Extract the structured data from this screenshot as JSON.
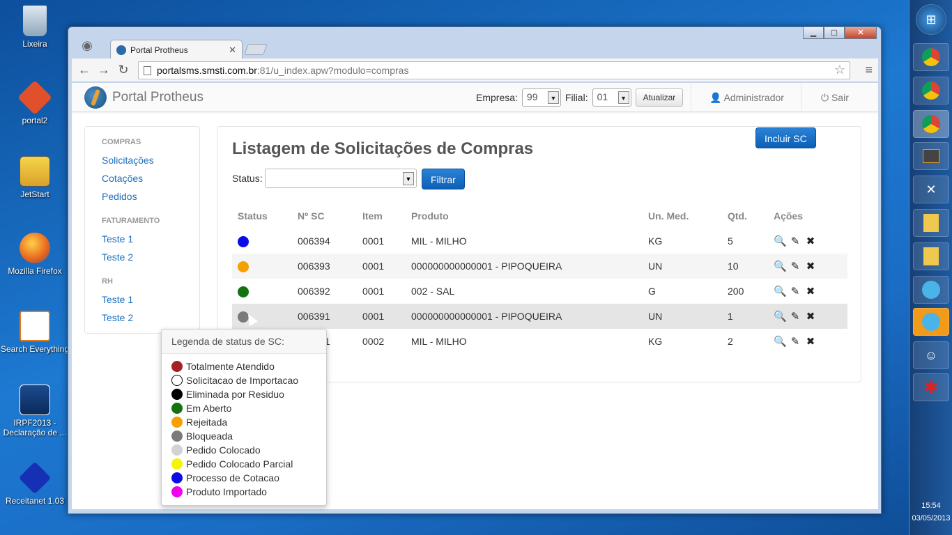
{
  "desktop": {
    "icons": [
      {
        "label": "Lixeira",
        "icon": "recycle-bin-icon"
      },
      {
        "label": "portal2",
        "icon": "git-icon"
      },
      {
        "label": "JetStart",
        "icon": "jetstart-icon"
      },
      {
        "label": "Mozilla Firefox",
        "icon": "firefox-icon"
      },
      {
        "label": "Search Everything",
        "icon": "search-everything-icon"
      },
      {
        "label": "IRPF2013 - Declaração de ...",
        "icon": "irpf-icon"
      },
      {
        "label": "Receitanet 1.03",
        "icon": "receitanet-icon"
      }
    ]
  },
  "taskbar": {
    "time": "15:54",
    "date": "03/05/2013"
  },
  "browser": {
    "tab_title": "Portal Protheus",
    "url_host": "portalsms.smsti.com.br",
    "url_rest": ":81/u_index.apw?modulo=compras"
  },
  "app": {
    "brand": "Portal Protheus",
    "empresa_label": "Empresa:",
    "empresa_value": "99",
    "filial_label": "Filial:",
    "filial_value": "01",
    "atualizar_label": "Atualizar",
    "user_label": "Administrador",
    "sair_label": "Sair"
  },
  "sidebar": {
    "sections": [
      {
        "title": "COMPRAS",
        "items": [
          "Solicitações",
          "Cotações",
          "Pedidos"
        ]
      },
      {
        "title": "FATURAMENTO",
        "items": [
          "Teste 1",
          "Teste 2"
        ]
      },
      {
        "title": "RH",
        "items": [
          "Teste 1",
          "Teste 2"
        ]
      }
    ]
  },
  "main": {
    "incluir_label": "Incluir SC",
    "title": "Listagem de Solicitações de Compras",
    "status_label": "Status:",
    "status_value": "",
    "filtrar_label": "Filtrar",
    "columns": [
      "Status",
      "Nº SC",
      "Item",
      "Produto",
      "Un. Med.",
      "Qtd.",
      "Ações"
    ],
    "rows": [
      {
        "status_color": "#0b0be6",
        "sc": "006394",
        "item": "0001",
        "produto": "MIL - MILHO",
        "un": "KG",
        "qtd": "5"
      },
      {
        "status_color": "#f5a000",
        "sc": "006393",
        "item": "0001",
        "produto": "000000000000001 - PIPOQUEIRA",
        "un": "UN",
        "qtd": "10"
      },
      {
        "status_color": "#137313",
        "sc": "006392",
        "item": "0001",
        "produto": "002 - SAL",
        "un": "G",
        "qtd": "200"
      },
      {
        "status_color": "#7a7a7a",
        "sc": "006391",
        "item": "0001",
        "produto": "000000000000001 - PIPOQUEIRA",
        "un": "UN",
        "qtd": "1"
      },
      {
        "status_color": "#0b0be6",
        "sc": "006391",
        "item": "0002",
        "produto": "MIL - MILHO",
        "un": "KG",
        "qtd": "2"
      }
    ]
  },
  "legend": {
    "title": "Legenda de status de SC:",
    "items": [
      {
        "label": "Totalmente Atendido",
        "color": "#a32323"
      },
      {
        "label": "Solicitacao de Importacao",
        "color": "#ffffff"
      },
      {
        "label": "Eliminada por Residuo",
        "color": "#000000"
      },
      {
        "label": "Em Aberto",
        "color": "#137313"
      },
      {
        "label": "Rejeitada",
        "color": "#f5a000"
      },
      {
        "label": "Bloqueada",
        "color": "#7a7a7a"
      },
      {
        "label": "Pedido Colocado",
        "color": "#d3d3d3"
      },
      {
        "label": "Pedido Colocado Parcial",
        "color": "#f5f500"
      },
      {
        "label": "Processo de Cotacao",
        "color": "#0b0be6"
      },
      {
        "label": "Produto Importado",
        "color": "#f000f0"
      }
    ]
  }
}
